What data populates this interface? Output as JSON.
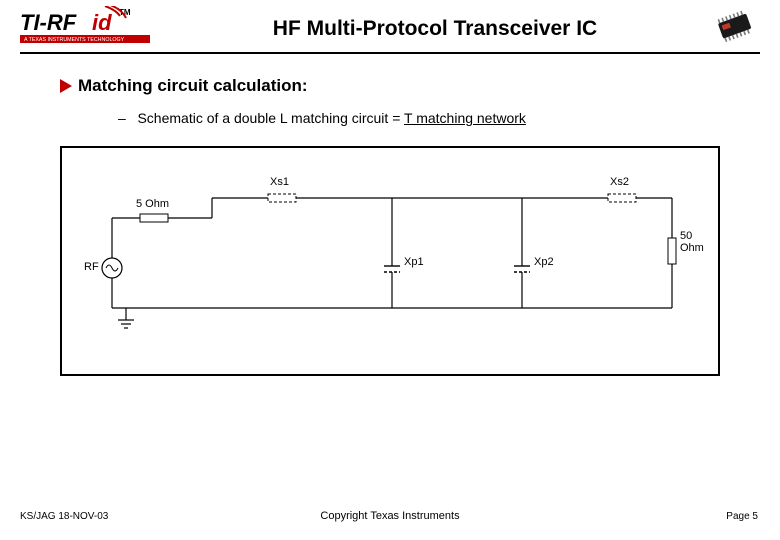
{
  "header": {
    "logo_main": "TI-RFid",
    "logo_sub": "A TEXAS INSTRUMENTS TECHNOLOGY",
    "title": "HF Multi-Protocol Transceiver IC"
  },
  "bullet": {
    "text": "Matching circuit calculation:"
  },
  "sub": {
    "dash": "–",
    "pre": "Schematic of a double L matching circuit = ",
    "under": "T matching network"
  },
  "schematic": {
    "xs1": "Xs1",
    "xs2": "Xs2",
    "xp1": "Xp1",
    "xp2": "Xp2",
    "src_r": "5 Ohm",
    "load_r": "50 Ohm",
    "rf": "RF"
  },
  "footer": {
    "left": "KS/JAG  18-NOV-03",
    "center": "Copyright Texas Instruments",
    "right": "Page 5"
  },
  "colors": {
    "accent_red": "#c00000"
  }
}
